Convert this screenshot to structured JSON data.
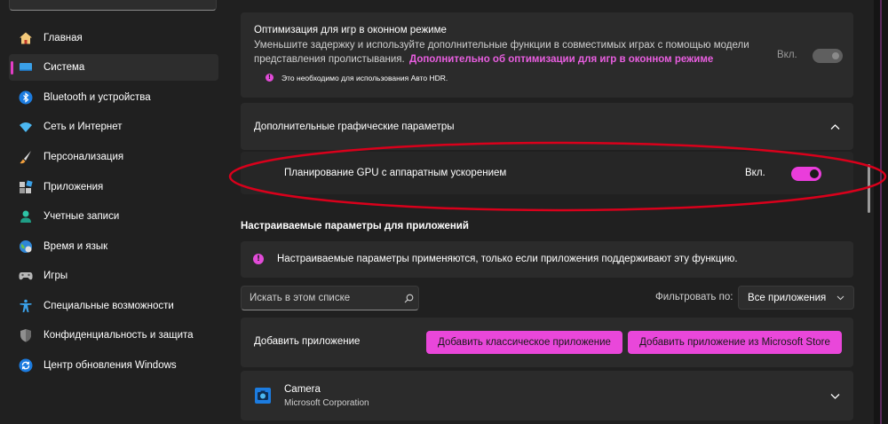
{
  "sidebar": {
    "items": [
      {
        "label": "Главная"
      },
      {
        "label": "Система"
      },
      {
        "label": "Bluetooth и устройства"
      },
      {
        "label": "Сеть и Интернет"
      },
      {
        "label": "Персонализация"
      },
      {
        "label": "Приложения"
      },
      {
        "label": "Учетные записи"
      },
      {
        "label": "Время и язык"
      },
      {
        "label": "Игры"
      },
      {
        "label": "Специальные возможности"
      },
      {
        "label": "Конфиденциальность и защита"
      },
      {
        "label": "Центр обновления Windows"
      }
    ]
  },
  "windowed_games": {
    "title": "Оптимизация для игр в оконном режиме",
    "desc_line1": "Уменьшите задержку и используйте дополнительные функции в совместимых играх с помощью модели",
    "desc_line2_prefix": "представления пролистывания.",
    "desc_link": "Дополнительно об оптимизации для игр в оконном режиме",
    "note": "Это необходимо для использования Авто HDR.",
    "toggle_label": "Вкл."
  },
  "advanced_graphics": {
    "title": "Дополнительные графические параметры",
    "gpu_label": "Планирование GPU с аппаратным ускорением",
    "gpu_toggle_label": "Вкл."
  },
  "custom_apps": {
    "heading": "Настраиваемые параметры для приложений",
    "info": "Настраиваемые параметры применяются, только если приложения поддерживают эту функцию.",
    "search_placeholder": "Искать в этом списке",
    "filter_label": "Фильтровать по:",
    "filter_value": "Все приложения",
    "add_app_label": "Добавить приложение",
    "add_classic_button": "Добавить классическое приложение",
    "add_store_button": "Добавить приложение из Microsoft Store",
    "apps": [
      {
        "name": "Camera",
        "publisher": "Microsoft Corporation"
      }
    ]
  },
  "colors": {
    "accent": "#e947da",
    "annotation": "#d9001b"
  }
}
